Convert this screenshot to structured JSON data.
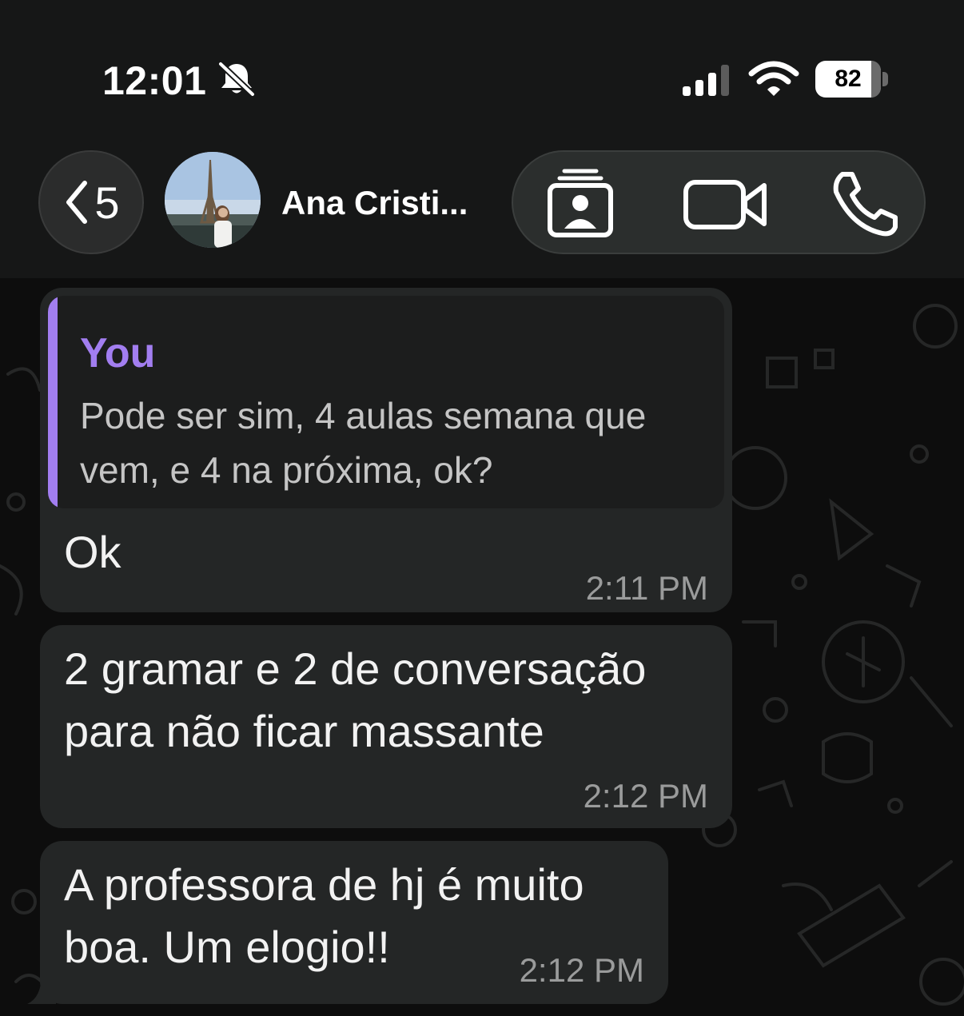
{
  "status_bar": {
    "time": "12:01",
    "battery": "82",
    "icons": [
      "bell-slash-icon",
      "cellular-signal-icon",
      "wifi-icon",
      "battery-icon"
    ]
  },
  "header": {
    "back_count": "5",
    "contact_name": "Ana Cristi...",
    "action_icons": [
      "contact-cards-icon",
      "video-camera-icon",
      "phone-icon"
    ]
  },
  "messages": [
    {
      "quote": {
        "author": "You",
        "text": "Pode ser sim, 4 aulas semana que vem, e 4 na próxima, ok?"
      },
      "text": "Ok",
      "time": "2:11 PM"
    },
    {
      "text_lines": [
        "2 gramar e 2 de conversação",
        "para não ficar massante"
      ],
      "time": "2:12 PM"
    },
    {
      "text_lines": [
        "A professora de hj é muito",
        "boa. Um elogio!!"
      ],
      "time": "2:12 PM"
    }
  ],
  "colors": {
    "background": "#0b0b0b",
    "bar": "#161717",
    "bubble": "#242626",
    "quote_accent": "#a27ef0",
    "time_text": "#9a9b9b"
  }
}
